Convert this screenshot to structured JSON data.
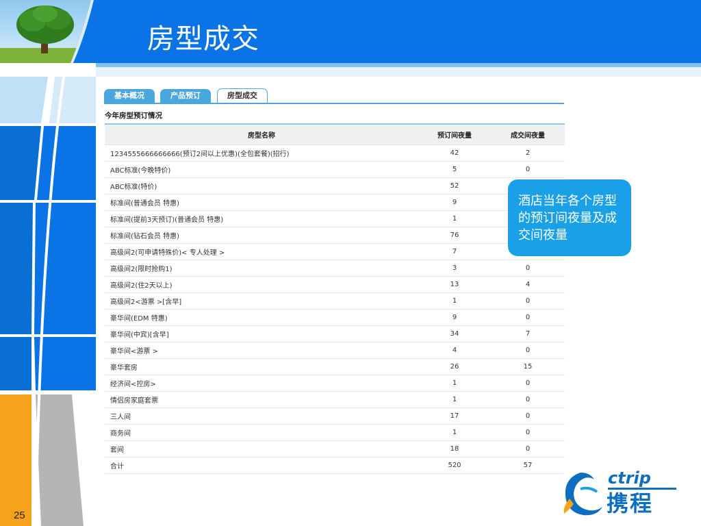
{
  "header": {
    "title": "房型成交"
  },
  "page_number": "25",
  "tabs": [
    {
      "label": "基本概况",
      "active": false
    },
    {
      "label": "产品预订",
      "active": false
    },
    {
      "label": "房型成交",
      "active": true
    }
  ],
  "section_title": "今年房型预订情况",
  "table": {
    "headers": [
      "房型名称",
      "预订间夜量",
      "成交间夜量"
    ],
    "rows": [
      [
        "1234555666666666(预订2间以上优惠)(全包套餐)(招行)",
        "42",
        "2"
      ],
      [
        "ABC标准(今晚特价)",
        "5",
        "0"
      ],
      [
        "ABC标准(特价)",
        "52",
        ""
      ],
      [
        "标准间(普通会员 特惠)",
        "9",
        ""
      ],
      [
        "标准间(提前3天预订)(普通会员 特惠)",
        "1",
        ""
      ],
      [
        "标准间(钻石会员 特惠)",
        "76",
        ""
      ],
      [
        "高级间2(可申请特殊价)< 专人处理 >",
        "7",
        ""
      ],
      [
        "高级间2(限时抢购1)",
        "3",
        "0"
      ],
      [
        "高级间2(住2天以上)",
        "13",
        "4"
      ],
      [
        "高级间2<游票 >[含早]",
        "1",
        "0"
      ],
      [
        "豪华间(EDM 特惠)",
        "9",
        "0"
      ],
      [
        "豪华间(中宾)[含早]",
        "34",
        "7"
      ],
      [
        "豪华间<游票 >",
        "4",
        "0"
      ],
      [
        "豪华套房",
        "26",
        "15"
      ],
      [
        "经济间<控房>",
        "1",
        "0"
      ],
      [
        "情侣房家庭套票",
        "1",
        "0"
      ],
      [
        "三人间",
        "17",
        "0"
      ],
      [
        "商务间",
        "1",
        "0"
      ],
      [
        "套间",
        "18",
        "0"
      ],
      [
        "合计",
        "520",
        "57"
      ]
    ]
  },
  "callout": {
    "text": "酒店当年各个房型的预订间夜量及成交间夜量"
  },
  "logo": {
    "en": "ctrip",
    "zh": "携程"
  },
  "colors": {
    "header_blue": "#0a73e6",
    "accent_blue": "#4aa6de",
    "callout_blue": "#1aa0e6",
    "orange": "#f7a21b"
  }
}
